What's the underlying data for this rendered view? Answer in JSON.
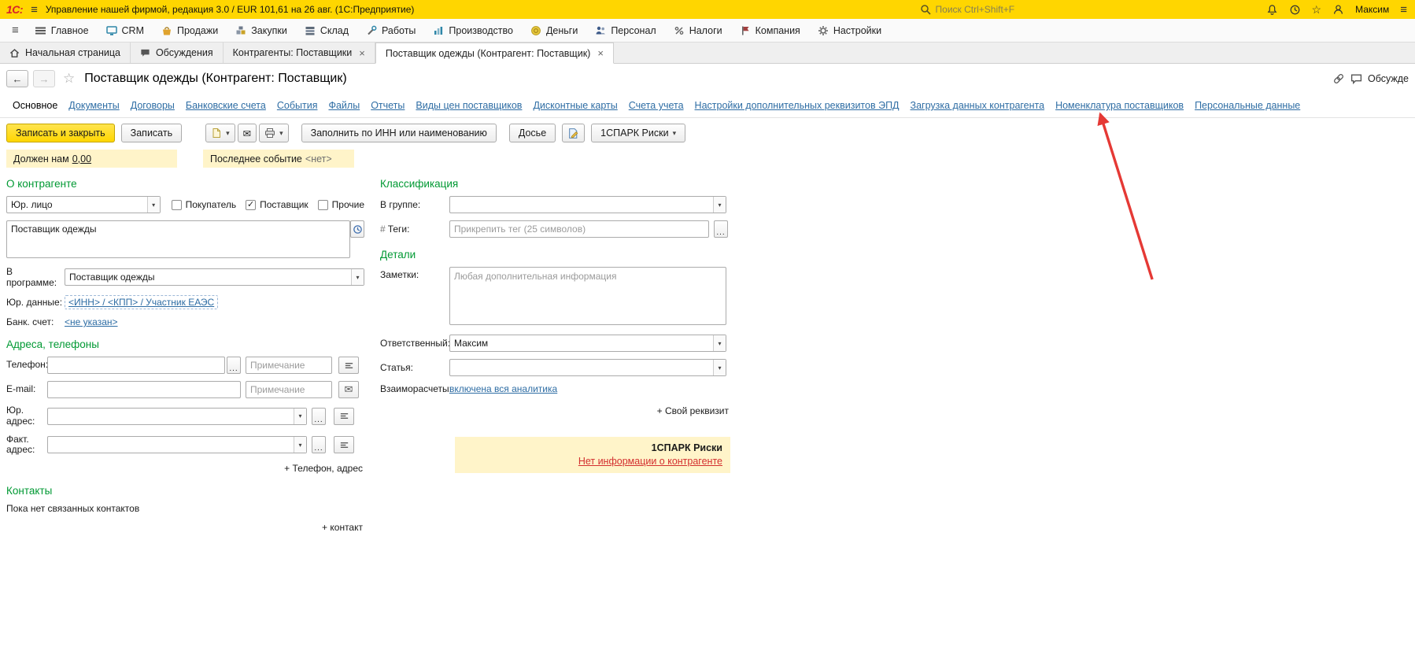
{
  "titlebar": {
    "logo": "1С:",
    "app_title": "Управление нашей фирмой, редакция 3.0 / EUR 101,61 на 26 авг.  (1С:Предприятие)",
    "search_placeholder": "Поиск Ctrl+Shift+F",
    "user_name": "Максим"
  },
  "menubar": {
    "items": [
      {
        "label": "Главное"
      },
      {
        "label": "CRM"
      },
      {
        "label": "Продажи"
      },
      {
        "label": "Закупки"
      },
      {
        "label": "Склад"
      },
      {
        "label": "Работы"
      },
      {
        "label": "Производство"
      },
      {
        "label": "Деньги"
      },
      {
        "label": "Персонал"
      },
      {
        "label": "Налоги"
      },
      {
        "label": "Компания"
      },
      {
        "label": "Настройки"
      }
    ]
  },
  "tabbar": {
    "items": [
      {
        "label": "Начальная страница"
      },
      {
        "label": "Обсуждения"
      },
      {
        "label": "Контрагенты: Поставщики",
        "close": "×"
      },
      {
        "label": "Поставщик одежды (Контрагент: Поставщик)",
        "close": "×"
      }
    ]
  },
  "pagehead": {
    "title": "Поставщик одежды (Контрагент: Поставщик)",
    "discuss_label": "Обсужде"
  },
  "nav": {
    "items": [
      {
        "label": "Основное"
      },
      {
        "label": "Документы"
      },
      {
        "label": "Договоры"
      },
      {
        "label": "Банковские счета"
      },
      {
        "label": "События"
      },
      {
        "label": "Файлы"
      },
      {
        "label": "Отчеты"
      },
      {
        "label": "Виды цен поставщиков"
      },
      {
        "label": "Дисконтные карты"
      },
      {
        "label": "Счета учета"
      },
      {
        "label": "Настройки дополнительных реквизитов ЭПД"
      },
      {
        "label": "Загрузка данных контрагента"
      },
      {
        "label": "Номенклатура поставщиков"
      },
      {
        "label": "Персональные данные"
      }
    ]
  },
  "toolbar": {
    "save_close": "Записать и закрыть",
    "save": "Записать",
    "fill_by_inn": "Заполнить по ИНН или наименованию",
    "dossier": "Досье",
    "spark": "1СПАРК Риски"
  },
  "info": {
    "owes_label": "Должен нам",
    "owes_value": "0,00",
    "last_event_label": "Последнее событие",
    "last_event_value": "<нет>"
  },
  "about": {
    "header": "О контрагенте",
    "type_value": "Юр. лицо",
    "checkboxes": [
      {
        "label": "Покупатель",
        "checked": false,
        "glyph": ""
      },
      {
        "label": "Поставщик",
        "checked": true,
        "glyph": "✓"
      },
      {
        "label": "Прочие",
        "checked": false,
        "glyph": ""
      }
    ],
    "name_value": "Поставщик одежды",
    "in_program_label": "В программе:",
    "in_program_value": "Поставщик одежды",
    "legal_label": "Юр. данные:",
    "legal_link": "<ИНН> / <КПП> / Участник ЕАЭС",
    "bank_label": "Банк. счет:",
    "bank_link": "<не указан>"
  },
  "addresses": {
    "header": "Адреса, телефоны",
    "phone_label": "Телефон:",
    "email_label": "E-mail:",
    "legal_addr_label": "Юр. адрес:",
    "fact_addr_label": "Факт. адрес:",
    "note_placeholder": "Примечание",
    "add_link": "+ Телефон, адрес"
  },
  "contacts": {
    "header": "Контакты",
    "empty_text": "Пока нет связанных контактов",
    "add_link": "+ контакт"
  },
  "classification": {
    "header": "Классификация",
    "group_label": "В группе:",
    "tags_hash": "#",
    "tags_label": "Теги:",
    "tags_placeholder": "Прикрепить тег (25 символов)"
  },
  "details": {
    "header": "Детали",
    "notes_label": "Заметки:",
    "notes_placeholder": "Любая дополнительная информация",
    "responsible_label": "Ответственный:",
    "responsible_value": "Максим",
    "article_label": "Статья:",
    "settlements_label": "Взаиморасчеты:",
    "settlements_link": "включена вся аналитика",
    "custom_attr_link": "+ Свой реквизит"
  },
  "spark": {
    "title": "1СПАРК Риски",
    "link": "Нет информации о контрагенте"
  },
  "icons": {
    "hamburger": "≡",
    "close": "×",
    "back": "←",
    "forward": "→",
    "star_outline": "☆",
    "dropdown": "▾",
    "ellipsis": "...",
    "envelope": "✉",
    "checkmark": "✓"
  },
  "colors": {
    "titlebar_yellow": "#FFD600",
    "section_green": "#009933",
    "link_blue": "#2E6DA4",
    "primary_button_yellow": "#FFDD2D",
    "highlight_yellow": "#FFF4C9",
    "alert_red": "#D32F2F",
    "arrow_red": "#E53935"
  }
}
